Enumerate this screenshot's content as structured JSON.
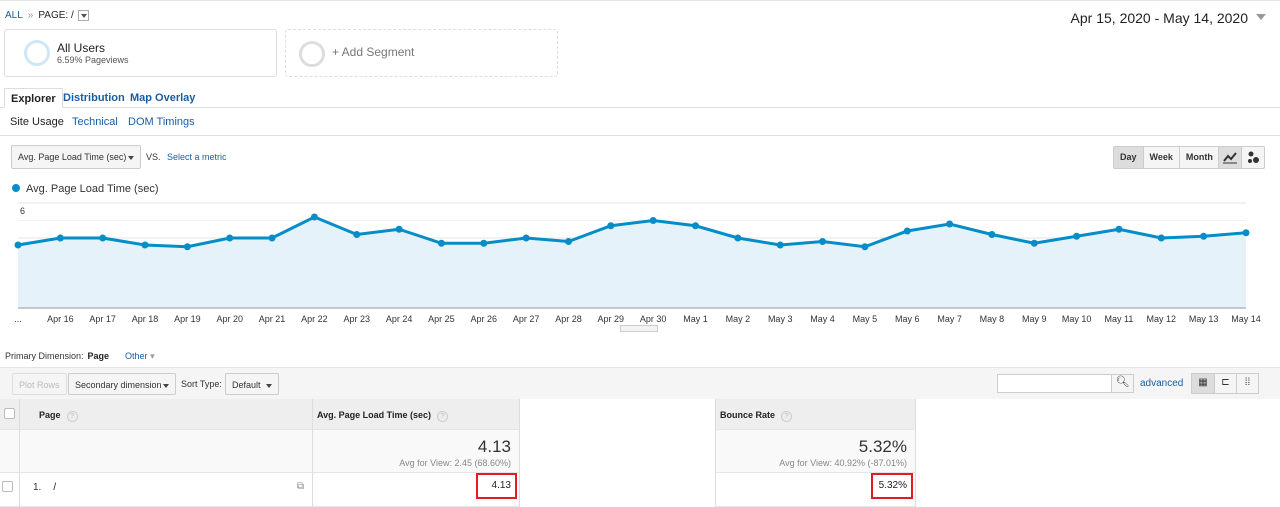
{
  "breadcrumb": {
    "root": "ALL",
    "separator": "»",
    "current": "PAGE: /"
  },
  "date_range": "Apr 15, 2020 - May 14, 2020",
  "segments": [
    {
      "title": "All Users",
      "subtitle": "6.59% Pageviews"
    },
    {
      "title": "+ Add Segment"
    }
  ],
  "tabs": [
    {
      "label": "Explorer",
      "active": true
    },
    {
      "label": "Distribution"
    },
    {
      "label": "Map Overlay"
    }
  ],
  "subtabs": [
    {
      "label": "Site Usage",
      "active": true
    },
    {
      "label": "Technical"
    },
    {
      "label": "DOM Timings"
    }
  ],
  "metric_selector": {
    "value": "Avg. Page Load Time (sec)",
    "vs": "VS.",
    "select_label": "Select a metric"
  },
  "granularity": {
    "options": [
      "Day",
      "Week",
      "Month"
    ],
    "selected": "Day"
  },
  "chart_type_buttons": [
    "line-chart-icon",
    "motion-chart-icon"
  ],
  "chart_data": {
    "type": "area",
    "series": [
      {
        "name": "Avg. Page Load Time (sec)",
        "color": "#058dc7",
        "values": [
          3.6,
          4.0,
          4.0,
          3.6,
          3.5,
          4.0,
          4.0,
          5.2,
          4.2,
          4.5,
          3.7,
          3.7,
          4.0,
          3.8,
          4.7,
          5.0,
          4.7,
          4.0,
          3.6,
          3.8,
          3.5,
          4.4,
          4.8,
          4.2,
          3.7,
          4.1,
          4.5,
          4.0,
          4.1,
          4.3
        ]
      }
    ],
    "x": [
      "Apr 15",
      "Apr 16",
      "Apr 17",
      "Apr 18",
      "Apr 19",
      "Apr 20",
      "Apr 21",
      "Apr 22",
      "Apr 23",
      "Apr 24",
      "Apr 25",
      "Apr 26",
      "Apr 27",
      "Apr 28",
      "Apr 29",
      "Apr 30",
      "May 1",
      "May 2",
      "May 3",
      "May 4",
      "May 5",
      "May 6",
      "May 7",
      "May 8",
      "May 9",
      "May 10",
      "May 11",
      "May 12",
      "May 13",
      "May 14"
    ],
    "first_tick_label": "...",
    "y_ticks": [
      "2",
      "4",
      "6"
    ],
    "ylim": [
      0,
      6
    ],
    "grid": true,
    "legend": "top-left"
  },
  "primary_dimension": {
    "label": "Primary Dimension:",
    "value": "Page",
    "other": "Other"
  },
  "toolbar": {
    "plot_rows": "Plot Rows",
    "secondary_dimension": "Secondary dimension",
    "sort_type_label": "Sort Type:",
    "sort_type": "Default",
    "search_placeholder": "",
    "advanced": "advanced"
  },
  "table": {
    "columns": [
      "Page",
      "Avg. Page Load Time (sec)",
      "Bounce Rate"
    ],
    "totals": {
      "load_time": "4.13",
      "load_time_sub": "Avg for View: 2.45 (68.60%)",
      "bounce": "5.32%",
      "bounce_sub": "Avg for View: 40.92% (-87.01%)"
    },
    "rows": [
      {
        "index": "1.",
        "page": "/",
        "load_time": "4.13",
        "bounce": "5.32%"
      }
    ],
    "highlight_color": "#e31b23"
  }
}
